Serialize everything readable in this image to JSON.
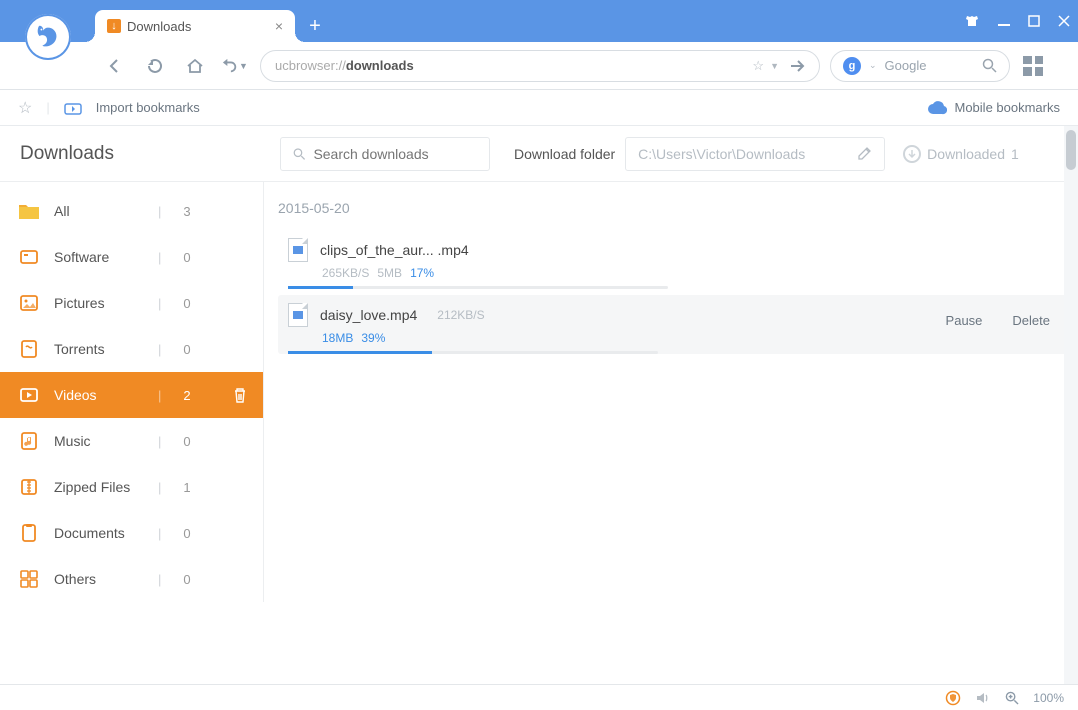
{
  "window": {
    "tab_title": "Downloads"
  },
  "toolbar": {
    "url_prefix": "ucbrowser://",
    "url_path": "downloads",
    "search_engine_label": "Google"
  },
  "bookmark_bar": {
    "import_label": "Import bookmarks",
    "mobile_label": "Mobile bookmarks"
  },
  "page": {
    "title": "Downloads",
    "search_placeholder": "Search downloads",
    "folder_label": "Download folder",
    "folder_path": "C:\\Users\\Victor\\Downloads",
    "downloaded_label": "Downloaded",
    "downloaded_count": "1"
  },
  "sidebar": {
    "categories": [
      {
        "label": "All",
        "count": "3",
        "active": false
      },
      {
        "label": "Software",
        "count": "0",
        "active": false
      },
      {
        "label": "Pictures",
        "count": "0",
        "active": false
      },
      {
        "label": "Torrents",
        "count": "0",
        "active": false
      },
      {
        "label": "Videos",
        "count": "2",
        "active": true
      },
      {
        "label": "Music",
        "count": "0",
        "active": false
      },
      {
        "label": "Zipped Files",
        "count": "1",
        "active": false
      },
      {
        "label": "Documents",
        "count": "0",
        "active": false
      },
      {
        "label": "Others",
        "count": "0",
        "active": false
      }
    ]
  },
  "downloads": {
    "date": "2015-05-20",
    "items": [
      {
        "name": "clips_of_the_aur... .mp4",
        "speed": "265KB/S",
        "size": "5MB",
        "percent_label": "17%",
        "percent": 17,
        "hovered": false
      },
      {
        "name": "daisy_love.mp4",
        "speed": "212KB/S",
        "size": "18MB",
        "percent_label": "39%",
        "percent": 39,
        "hovered": true
      }
    ],
    "actions": {
      "pause": "Pause",
      "delete": "Delete"
    }
  },
  "statusbar": {
    "zoom": "100%"
  }
}
